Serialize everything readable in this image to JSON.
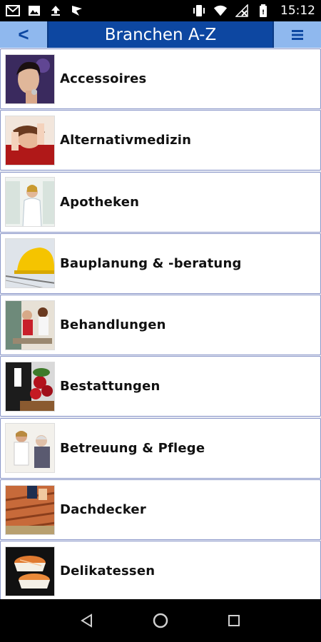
{
  "status_bar": {
    "time": "15:12",
    "left_icons": [
      "gmail-icon",
      "image-icon",
      "upload-icon",
      "flag-icon"
    ],
    "right_icons": [
      "vibrate-icon",
      "wifi-icon",
      "no-signal-icon",
      "battery-icon"
    ]
  },
  "app_bar": {
    "back_label": "<",
    "title": "Branchen A-Z",
    "menu_icon": "hamburger-menu-icon",
    "color": "#0d47a1",
    "button_color": "#8fb8ee"
  },
  "list": {
    "items": [
      {
        "label": "Accessoires",
        "thumb": "accessoires-image"
      },
      {
        "label": "Alternativmedizin",
        "thumb": "alternativmedizin-image"
      },
      {
        "label": "Apotheken",
        "thumb": "apotheken-image"
      },
      {
        "label": "Bauplanung & -beratung",
        "thumb": "bauplanung-image"
      },
      {
        "label": "Behandlungen",
        "thumb": "behandlungen-image"
      },
      {
        "label": "Bestattungen",
        "thumb": "bestattungen-image"
      },
      {
        "label": "Betreuung & Pflege",
        "thumb": "betreuung-image"
      },
      {
        "label": "Dachdecker",
        "thumb": "dachdecker-image"
      },
      {
        "label": "Delikatessen",
        "thumb": "delikatessen-image"
      }
    ]
  },
  "nav_bar": {
    "buttons": [
      "back-triangle-icon",
      "home-circle-icon",
      "recents-square-icon"
    ]
  }
}
